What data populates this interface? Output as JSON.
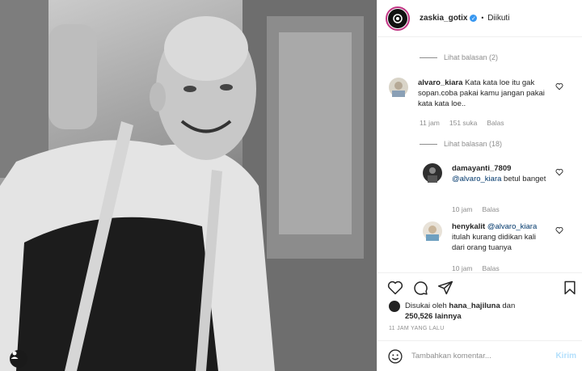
{
  "header": {
    "username": "zaskia_gotix",
    "separator": "•",
    "follow_status": "Diikuti"
  },
  "comments": {
    "view_replies_1": "Lihat balasan (2)",
    "c1": {
      "username": "alvaro_kiara",
      "text": "Kata kata loe itu gak sopan.coba pakai kamu jangan pakai kata kata loe..",
      "time": "11 jam",
      "likes": "151 suka",
      "reply": "Balas"
    },
    "view_replies_2": "Lihat balasan (18)",
    "r1": {
      "username": "damayanti_7809",
      "mention": "@alvaro_kiara",
      "text": "betul banget",
      "time": "10 jam",
      "reply": "Balas"
    },
    "r2": {
      "username": "henykalit",
      "mention": "@alvaro_kiara",
      "text": "itulah kurang didikan kali dari orang tuanya",
      "time": "10 jam",
      "reply": "Balas"
    }
  },
  "likes": {
    "prefix": "Disukai oleh",
    "user": "hana_hajiluna",
    "connector": "dan",
    "count": "250,526",
    "suffix": "lainnya"
  },
  "timestamp": "11 JAM YANG LALU",
  "composer": {
    "placeholder": "Tambahkan komentar...",
    "post_label": "Kirim"
  },
  "icons": {
    "like": "heart-icon",
    "comment": "comment-icon",
    "share": "share-icon",
    "save": "bookmark-icon",
    "emoji": "emoji-icon",
    "tag": "user-tag-icon"
  },
  "colors": {
    "verified": "#3897f0",
    "mention": "#00376b",
    "muted": "#8e8e8e",
    "post_disabled": "#b2dffc"
  }
}
